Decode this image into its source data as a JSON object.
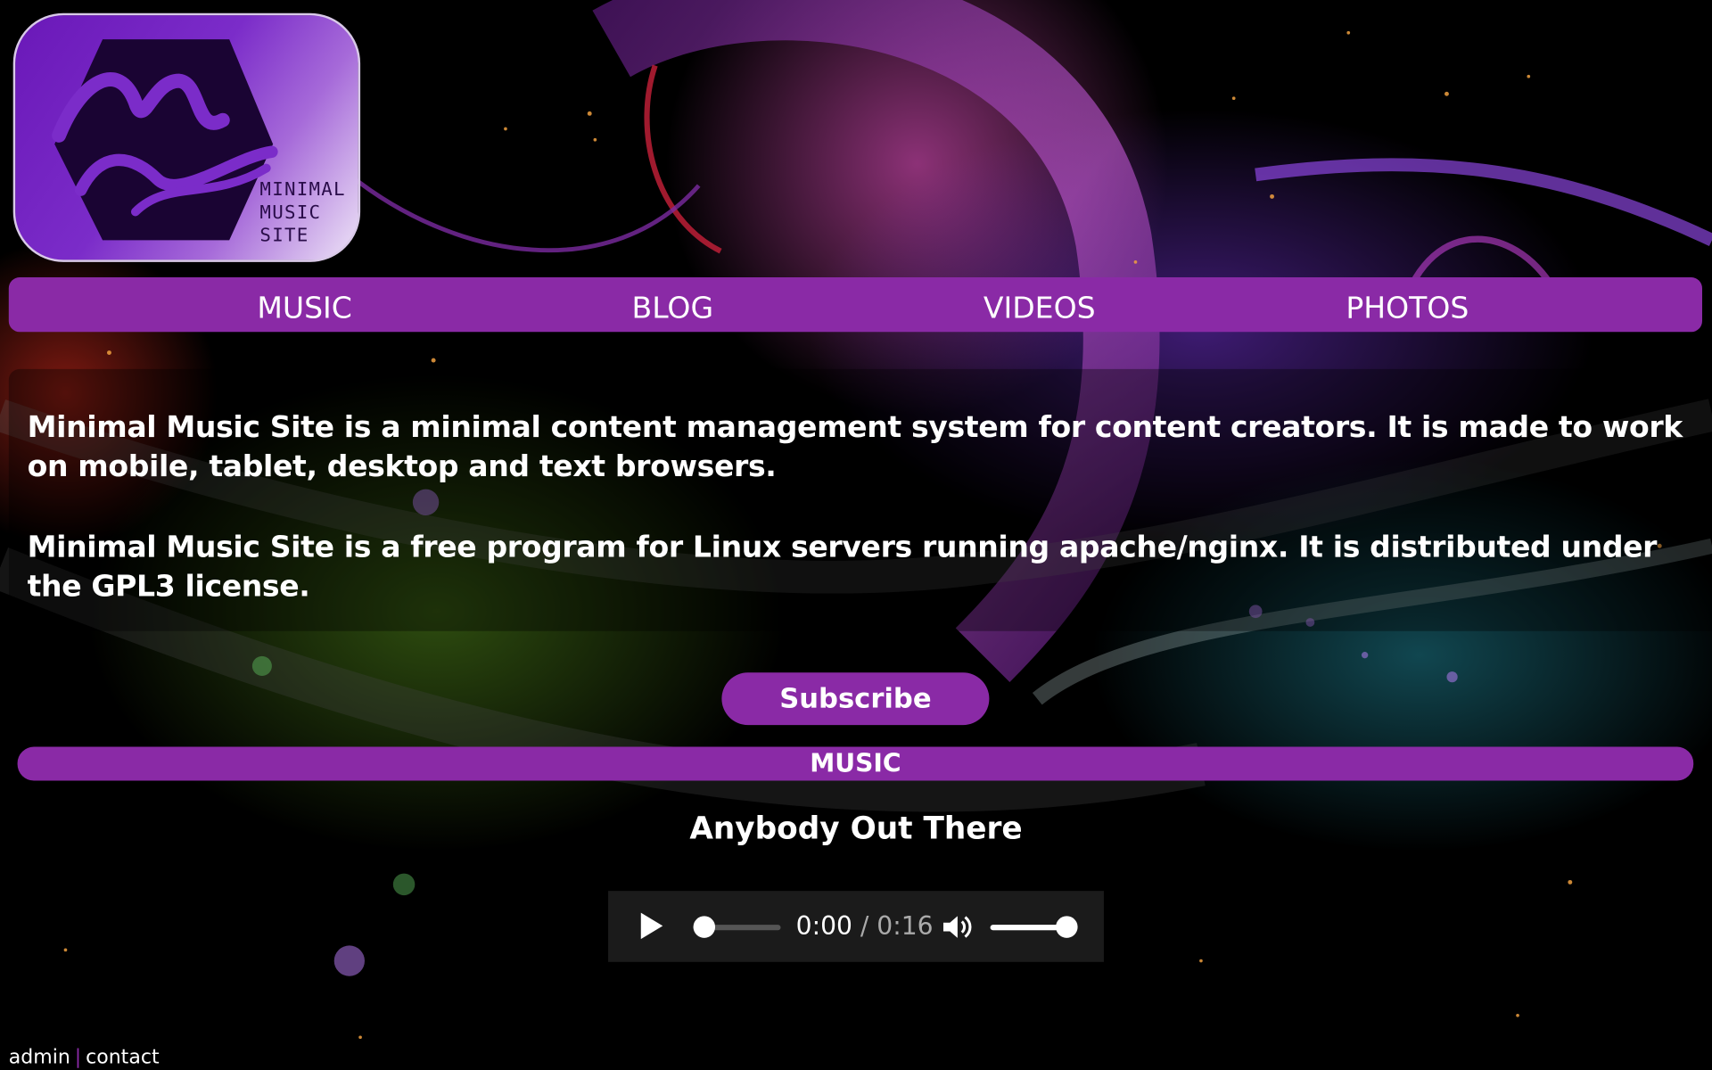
{
  "logo": {
    "lines": [
      "MINIMAL",
      "MUSIC",
      "SITE"
    ],
    "accent": "#7b2cc9"
  },
  "nav": {
    "items": [
      {
        "label": "MUSIC"
      },
      {
        "label": "BLOG"
      },
      {
        "label": "VIDEOS"
      },
      {
        "label": "PHOTOS"
      }
    ],
    "color": "#8a2aa6"
  },
  "intro": {
    "paragraph1": "Minimal Music Site is a minimal content management system for content creators. It is made to work on mobile, tablet, desktop and text browsers.",
    "paragraph2": "Minimal Music Site is a free program for Linux servers running apache/nginx. It is distributed under the GPL3 license."
  },
  "subscribe": {
    "label": "Subscribe"
  },
  "music_section": {
    "label": "MUSIC"
  },
  "track": {
    "title": "Anybody Out There",
    "player": {
      "current_time": "0:00",
      "separator": " / ",
      "duration": "0:16",
      "progress": 0.0,
      "volume": 1.0,
      "play_icon": "play-icon",
      "volume_icon": "volume-icon"
    }
  },
  "footer": {
    "admin_label": "admin",
    "separator": "|",
    "contact_label": "contact"
  }
}
